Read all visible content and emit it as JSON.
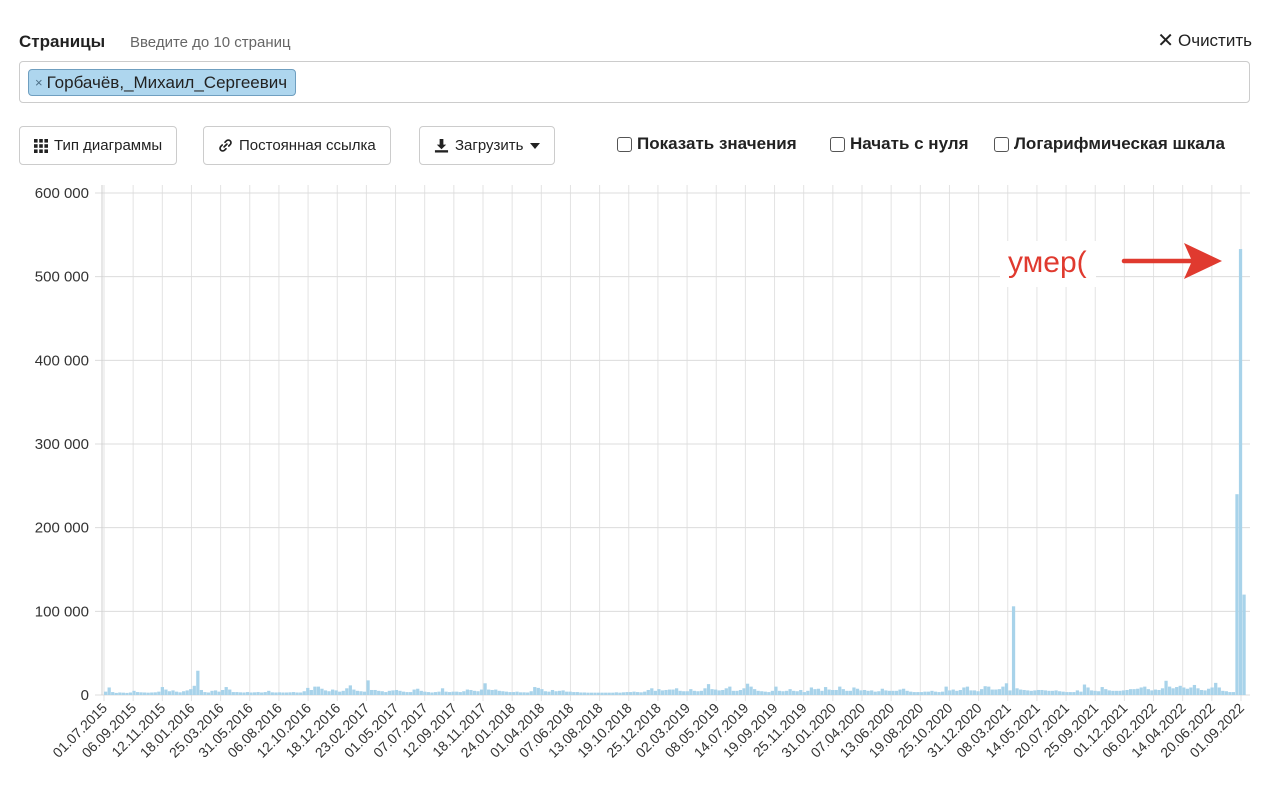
{
  "header": {
    "title": "Страницы",
    "hint": "Введите до 10 страниц",
    "clear_label": "Очистить"
  },
  "pages": [
    {
      "label": "Горбачёв,_Михаил_Сергеевич"
    }
  ],
  "toolbar": {
    "chart_type_label": "Тип диаграммы",
    "permalink_label": "Постоянная ссылка",
    "download_label": "Загрузить"
  },
  "options": {
    "show_values": "Показать значения",
    "begin_at_zero": "Начать с нуля",
    "log_scale": "Логарифмическая шкала"
  },
  "chart_data": {
    "type": "bar",
    "color": "#a8d3ea",
    "annotation_color": "#e03a2f",
    "annotation": "умер(",
    "ylim": [
      0,
      600000
    ],
    "y_ticks": [
      "0",
      "100 000",
      "200 000",
      "300 000",
      "400 000",
      "500 000",
      "600 000"
    ],
    "x_ticks": [
      "01.07.2015",
      "06.09.2015",
      "12.11.2015",
      "18.01.2016",
      "25.03.2016",
      "31.05.2016",
      "06.08.2016",
      "12.10.2016",
      "18.12.2016",
      "23.02.2017",
      "01.05.2017",
      "07.07.2017",
      "12.09.2017",
      "18.11.2017",
      "24.01.2018",
      "01.04.2018",
      "07.06.2018",
      "13.08.2018",
      "19.10.2018",
      "25.12.2018",
      "02.03.2019",
      "08.05.2019",
      "14.07.2019",
      "19.09.2019",
      "25.11.2019",
      "31.01.2020",
      "07.04.2020",
      "13.06.2020",
      "19.08.2020",
      "25.10.2020",
      "31.12.2020",
      "08.03.2021",
      "14.05.2021",
      "20.07.2021",
      "25.09.2021",
      "01.12.2021",
      "06.02.2022",
      "14.04.2022",
      "20.06.2022",
      "01.09.2022"
    ],
    "weekly_values": [
      4000,
      9000,
      3500,
      2500,
      3000,
      2800,
      2500,
      3000,
      5000,
      3500,
      3200,
      3000,
      2800,
      3000,
      3200,
      4000,
      9500,
      6500,
      4500,
      5500,
      4000,
      3200,
      4500,
      5500,
      7000,
      11000,
      29000,
      6000,
      3500,
      3000,
      5000,
      5500,
      4000,
      6000,
      9500,
      6500,
      3500,
      3500,
      3200,
      3000,
      3500,
      3000,
      3200,
      3500,
      3000,
      3500,
      5000,
      3200,
      3000,
      3200,
      3000,
      3000,
      3200,
      3500,
      3000,
      3000,
      4500,
      8500,
      6000,
      10000,
      10000,
      7500,
      5500,
      4500,
      6500,
      5500,
      4000,
      5000,
      8000,
      11500,
      6500,
      5000,
      4500,
      4000,
      17500,
      6000,
      6000,
      5000,
      4500,
      3500,
      5000,
      5500,
      6000,
      5000,
      4000,
      3500,
      3500,
      6500,
      7500,
      5000,
      4000,
      3500,
      3000,
      3500,
      4000,
      8000,
      4000,
      3500,
      4000,
      4000,
      3500,
      4500,
      6500,
      6000,
      5000,
      4500,
      6500,
      14000,
      6500,
      6000,
      6500,
      5000,
      4500,
      4000,
      3500,
      3500,
      4000,
      3200,
      3200,
      3000,
      4500,
      9500,
      8500,
      7000,
      4500,
      4000,
      6000,
      4500,
      5000,
      5500,
      4000,
      4000,
      3500,
      3500,
      3000,
      3000,
      2800,
      2800,
      2800,
      2800,
      2800,
      2800,
      2800,
      2800,
      3200,
      2800,
      3200,
      3500,
      3500,
      4000,
      3500,
      3200,
      4000,
      6000,
      8000,
      5000,
      7000,
      5500,
      6000,
      6500,
      6500,
      8000,
      5000,
      4500,
      4500,
      7000,
      5000,
      4500,
      5000,
      8000,
      13000,
      7000,
      6500,
      5500,
      6000,
      8000,
      10000,
      5000,
      5000,
      6000,
      8000,
      13500,
      10000,
      7000,
      5000,
      4500,
      4000,
      3500,
      5000,
      10000,
      5000,
      4500,
      5000,
      7000,
      5000,
      4500,
      6000,
      3500,
      5000,
      9000,
      7000,
      7500,
      5000,
      9500,
      6500,
      6000,
      6000,
      10000,
      7000,
      5000,
      5000,
      9000,
      7500,
      5500,
      6000,
      5000,
      5500,
      4000,
      4500,
      7500,
      5500,
      5000,
      5000,
      5000,
      6500,
      7500,
      5000,
      4000,
      3500,
      3500,
      3500,
      4000,
      4000,
      5000,
      4000,
      3500,
      4000,
      10000,
      5500,
      6500,
      5000,
      6000,
      9000,
      10000,
      5500,
      5500,
      4500,
      7000,
      10500,
      10000,
      6500,
      6500,
      7000,
      10000,
      14000,
      5500,
      106000,
      8000,
      6500,
      6000,
      5500,
      5000,
      5500,
      6000,
      6000,
      5500,
      5000,
      5000,
      5500,
      4500,
      4000,
      3500,
      3500,
      3500,
      5500,
      4000,
      12500,
      9000,
      5500,
      5000,
      4500,
      9500,
      7000,
      5500,
      5000,
      5000,
      5000,
      5500,
      6000,
      7000,
      7000,
      7500,
      9000,
      10000,
      7000,
      5500,
      6500,
      6000,
      8000,
      17000,
      10000,
      8000,
      9500,
      11000,
      9000,
      7500,
      9000,
      12000,
      8000,
      6000,
      5500,
      7500,
      9000,
      14500,
      9000,
      5000,
      4500,
      3500,
      3500,
      240000,
      533000,
      120000
    ]
  }
}
